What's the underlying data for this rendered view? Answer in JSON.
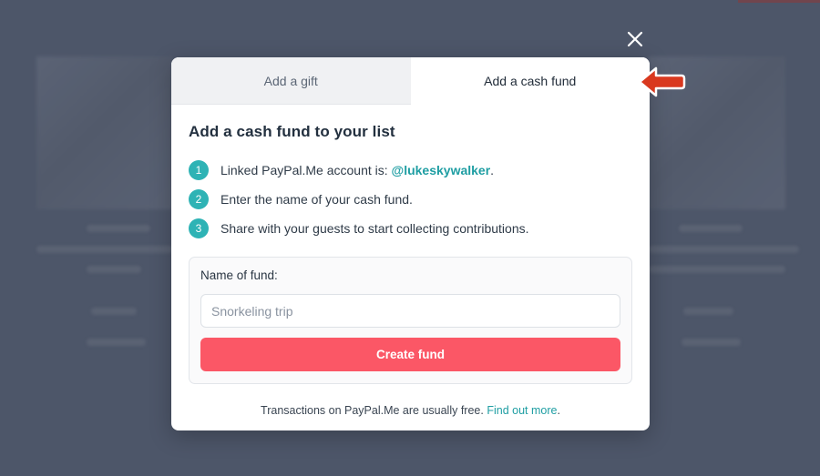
{
  "modal": {
    "tabs": [
      {
        "label": "Add a gift",
        "active": false
      },
      {
        "label": "Add a cash fund",
        "active": true
      }
    ],
    "heading": "Add a cash fund to your list",
    "steps": [
      {
        "number": "1",
        "text_before": "Linked PayPal.Me account is: ",
        "link": "@lukeskywalker",
        "text_after": "."
      },
      {
        "number": "2",
        "text": "Enter the name of your cash fund."
      },
      {
        "number": "3",
        "text": "Share with your guests to start collecting contributions."
      }
    ],
    "form": {
      "label": "Name of fund:",
      "placeholder": "Snorkeling trip",
      "value": "",
      "button_label": "Create fund"
    },
    "footer": {
      "text": "Transactions on PayPal.Me are usually free.",
      "link": "Find out more",
      "suffix": "."
    }
  },
  "icons": {
    "close": "close-icon",
    "annotation": "red-arrow-pointer-icon"
  },
  "colors": {
    "overlay": "#4d5669",
    "accent_teal": "#2eb3b5",
    "link": "#1f9ea3",
    "button_primary": "#fb5766",
    "arrow": "#d9391f"
  }
}
